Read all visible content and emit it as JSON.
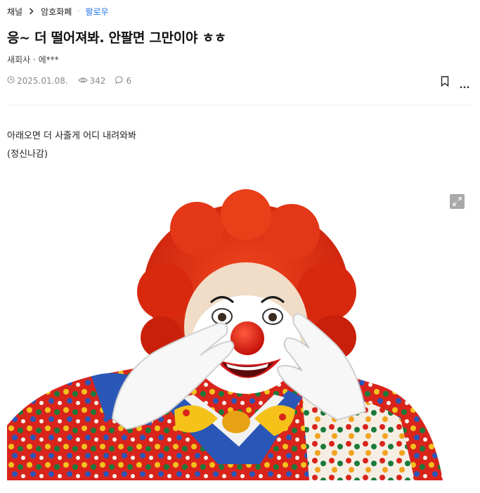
{
  "breadcrumb": {
    "channel": "채널",
    "board": "암호화폐",
    "separator": "·",
    "follow": "팔로우"
  },
  "post": {
    "title": "응~ 더 떨어져봐. 안팔면 그만이야 ㅎㅎ",
    "author": "새회사 · 에***",
    "date": "2025.01.08.",
    "views": "342",
    "comments": "6",
    "body_lines": [
      "아래오면 더 사줄게 어디 내려와봐",
      "(정신나감)"
    ]
  },
  "colors": {
    "accent": "#1f73e8",
    "muted": "#8a8a8a",
    "divider": "#ececec"
  },
  "icons": [
    "chevron-right-icon",
    "clock-icon",
    "eye-icon",
    "comment-icon",
    "bookmark-icon",
    "more-icon",
    "expand-icon"
  ]
}
